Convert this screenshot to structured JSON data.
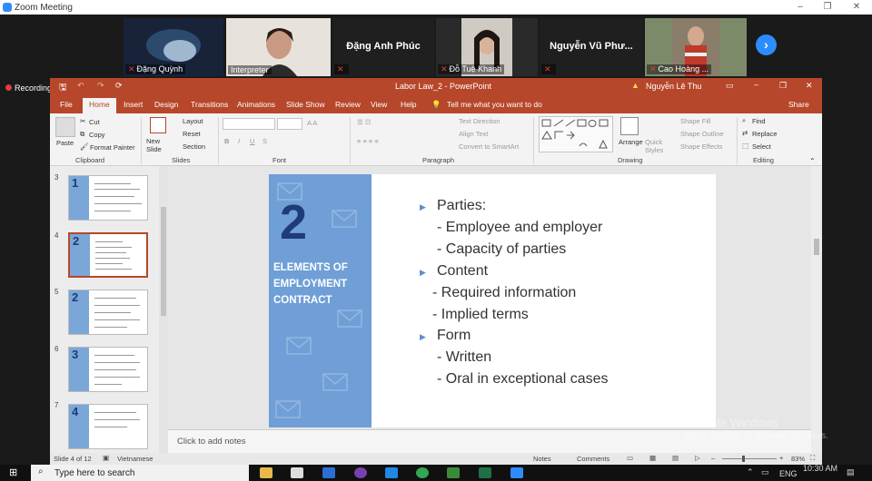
{
  "zoom": {
    "title": "Zoom Meeting",
    "minimize": "–",
    "restore": "❐",
    "close": "✕",
    "participants": [
      {
        "label": "Đặng Quỳnh",
        "name": ""
      },
      {
        "label": "Interpreter",
        "name": ""
      },
      {
        "label": "",
        "name": "Đặng Anh Phúc"
      },
      {
        "label": "Đỗ Tuệ Khanh",
        "name": ""
      },
      {
        "label": "",
        "name": "Nguyễn Vũ Phư..."
      },
      {
        "label": "Cao Hoàng ...",
        "name": ""
      }
    ],
    "next_icon": "chevron-right-icon",
    "recording": "Recording"
  },
  "ppt": {
    "title": "Labor Law_2 - PowerPoint",
    "user": "Nguyễn Lê Thu",
    "warning_icon": "warning-icon",
    "tabs": [
      "File",
      "Home",
      "Insert",
      "Design",
      "Transitions",
      "Animations",
      "Slide Show",
      "Review",
      "View",
      "Help"
    ],
    "tell_me": "Tell me what you want to do",
    "share": "Share",
    "ribbon": {
      "clipboard": {
        "paste": "Paste",
        "cut": "Cut",
        "copy": "Copy",
        "format_painter": "Format Painter",
        "label": "Clipboard"
      },
      "slides": {
        "new_slide": "New Slide",
        "layout": "Layout",
        "reset": "Reset",
        "section": "Section",
        "label": "Slides"
      },
      "font": {
        "label": "Font",
        "bold": "B",
        "italic": "I",
        "underline": "U",
        "strike": "S",
        "sizes": "A A"
      },
      "paragraph": {
        "label": "Paragraph",
        "text_direction": "Text Direction",
        "align_text": "Align Text",
        "smartart": "Convert to SmartArt"
      },
      "drawing": {
        "label": "Drawing",
        "arrange": "Arrange",
        "quick_styles": "Quick Styles",
        "shape_fill": "Shape Fill",
        "shape_outline": "Shape Outline",
        "shape_effects": "Shape Effects"
      },
      "editing": {
        "label": "Editing",
        "find": "Find",
        "replace": "Replace",
        "select": "Select"
      }
    },
    "thumbnails": [
      {
        "num": "3",
        "big": "1"
      },
      {
        "num": "4",
        "big": "2"
      },
      {
        "num": "5",
        "big": "2"
      },
      {
        "num": "6",
        "big": "3"
      },
      {
        "num": "7",
        "big": "4"
      }
    ],
    "slide": {
      "number": "2",
      "subtitle": "ELEMENTS OF EMPLOYMENT CONTRACT",
      "lines": [
        "Parties:",
        "- Employee and employer",
        "- Capacity of parties",
        "Content",
        "- Required information",
        "- Implied terms",
        "Form",
        "- Written",
        "- Oral in exceptional cases"
      ]
    },
    "notes_placeholder": "Click to add notes",
    "status": {
      "slide": "Slide 4 of 12",
      "language": "Vietnamese",
      "notes": "Notes",
      "comments": "Comments",
      "zoom": "83%"
    }
  },
  "watermark": {
    "line1": "Activate Windows",
    "line2": "Go to Settings to activate Windows."
  },
  "taskbar": {
    "search": "Type here to search",
    "lang": "ENG",
    "time": "10:30 AM"
  }
}
